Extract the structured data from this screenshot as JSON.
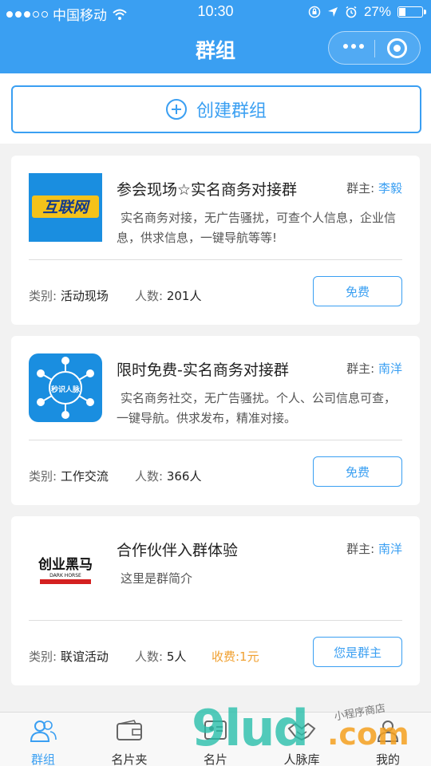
{
  "status_bar": {
    "carrier": "中国移动",
    "time": "10:30",
    "battery": "27%",
    "battery_level": 0.27
  },
  "nav": {
    "title": "群组"
  },
  "create": {
    "label": "创建群组"
  },
  "labels": {
    "owner_prefix": "群主:",
    "category_prefix": "类别:",
    "count_prefix": "人数:"
  },
  "groups": [
    {
      "name": "参会现场☆实名商务对接群",
      "owner": "李毅",
      "description": "实名商务对接，无广告骚扰，可查个人信息，企业信息，供求信息，一键导航等等!",
      "category": "活动现场",
      "members": "201人",
      "fee": "",
      "action": "免费",
      "logo_text": "互联网"
    },
    {
      "name": "限时免费-实名商务对接群",
      "owner": "南洋",
      "description": "实名商务社交，无广告骚扰。个人、公司信息可查，一键导航。供求发布，精准对接。",
      "category": "工作交流",
      "members": "366人",
      "fee": "",
      "action": "免费",
      "logo_text": "秒识人脉"
    },
    {
      "name": "合作伙伴入群体验",
      "owner": "南洋",
      "description": "这里是群简介",
      "category": "联谊活动",
      "members": "5人",
      "fee": "收费:1元",
      "action": "您是群主",
      "logo_text": "创业黑马",
      "logo_subtext": "DARK HORSE"
    }
  ],
  "tabs": [
    {
      "label": "群组",
      "icon": "group-icon",
      "active": true
    },
    {
      "label": "名片夹",
      "icon": "wallet-icon",
      "active": false
    },
    {
      "label": "名片",
      "icon": "card-icon",
      "active": false
    },
    {
      "label": "人脉库",
      "icon": "handshake-icon",
      "active": false
    },
    {
      "label": "我的",
      "icon": "person-icon",
      "active": false
    }
  ],
  "watermark": {
    "text": "9lud",
    "domain": ".com",
    "tagline": "小程序商店"
  },
  "colors": {
    "primary": "#3a9ff2",
    "fee": "#f0a030"
  }
}
